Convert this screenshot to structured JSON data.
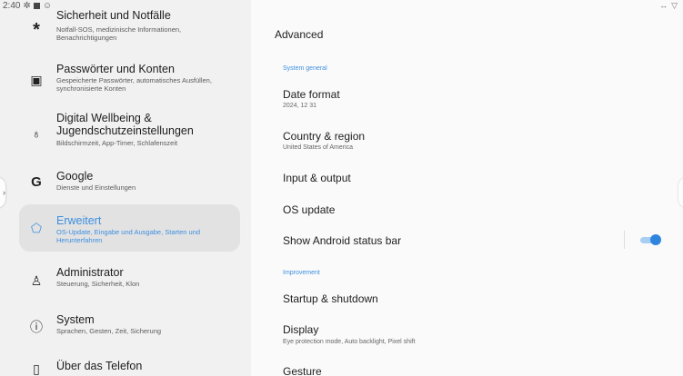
{
  "status_bar": {
    "time": "2:40"
  },
  "settings_menu": [
    {
      "icon": "asterisk-icon",
      "title": "Sicherheit und Notfälle",
      "subtitle": "Notfall-SOS, medizinische Informationen, Benachrichtigungen"
    },
    {
      "icon": "password-icon",
      "title": "Passwörter und Konten",
      "subtitle": "Gespeicherte Passwörter, automatisches Ausfüllen, synchronisierte Konten"
    },
    {
      "icon": "wellbeing-icon",
      "title": "Digital Wellbeing & Jugendschutzeinstellungen",
      "subtitle": "Bildschirmzeit, App-Timer, Schlafenszeit"
    },
    {
      "icon": "google-icon",
      "title": "Google",
      "subtitle": "Dienste und Einstellungen"
    },
    {
      "icon": "extension-icon",
      "title": "Erweitert",
      "subtitle": "OS-Update, Eingabe und Ausgabe, Starten und Herunterfahren",
      "active": true
    },
    {
      "icon": "admin-icon",
      "title": "Administrator",
      "subtitle": "Steuerung, Sicherheit, Klon"
    },
    {
      "icon": "info-icon",
      "title": "System",
      "subtitle": "Sprachen, Gesten, Zeit, Sicherung"
    },
    {
      "icon": "phone-icon",
      "title": "Über das Telefon",
      "subtitle": ""
    }
  ],
  "advanced": {
    "title": "Advanced",
    "section_system": "System general",
    "date_format": {
      "title": "Date format",
      "value": "2024, 12 31"
    },
    "country_region": {
      "title": "Country & region",
      "value": "United States of America"
    },
    "input_output": "Input & output",
    "os_update": "OS update",
    "status_bar_toggle": {
      "title": "Show Android status bar",
      "checked": true
    },
    "section_improvement": "Improvement",
    "startup_shutdown": "Startup & shutdown",
    "display": {
      "title": "Display",
      "value": "Eye protection mode, Auto backlight, Pixel shift"
    },
    "gesture": "Gesture"
  },
  "colors": {
    "accent": "#3d8fe0",
    "active_bg": "#e2e2e2"
  }
}
